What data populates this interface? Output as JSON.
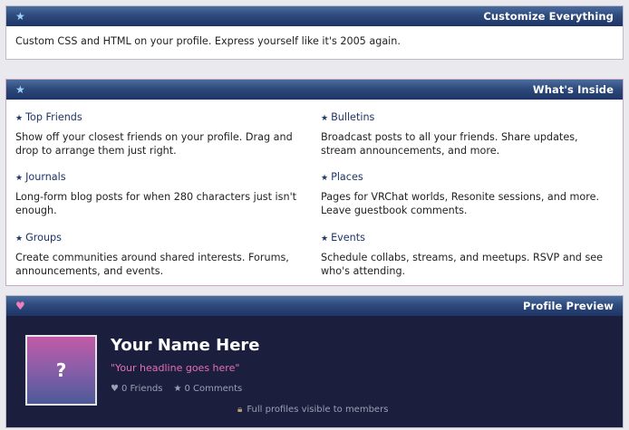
{
  "customize": {
    "title": "Customize Everything",
    "body": "Custom CSS and HTML on your profile. Express yourself like it's 2005 again."
  },
  "inside": {
    "title": "What's Inside",
    "features": [
      {
        "title": "Top Friends",
        "desc": "Show off your closest friends on your profile. Drag and drop to arrange them just right."
      },
      {
        "title": "Bulletins",
        "desc": "Broadcast posts to all your friends. Share updates, stream announcements, and more."
      },
      {
        "title": "Journals",
        "desc": "Long-form blog posts for when 280 characters just isn't enough."
      },
      {
        "title": "Places",
        "desc": "Pages for VRChat worlds, Resonite sessions, and more. Leave guestbook comments."
      },
      {
        "title": "Groups",
        "desc": "Create communities around shared interests. Forums, announcements, and events."
      },
      {
        "title": "Events",
        "desc": "Schedule collabs, streams, and meetups. RSVP and see who's attending."
      }
    ]
  },
  "preview": {
    "title": "Profile Preview",
    "avatar_glyph": "?",
    "name": "Your Name Here",
    "headline": "\"Your headline goes here\"",
    "friends": "0 Friends",
    "comments": "0 Comments",
    "members_note": "Full profiles visible to members"
  },
  "icons": {
    "star": "star-icon",
    "heart": "heart-icon",
    "lock": "lock-icon"
  },
  "colors": {
    "header_gradient_top": "#4c6c9e",
    "header_gradient_bottom": "#1e3566",
    "preview_bg": "#1b1f3d",
    "headline_pink": "#e271b6",
    "accent_star": "#9fd1ff"
  }
}
